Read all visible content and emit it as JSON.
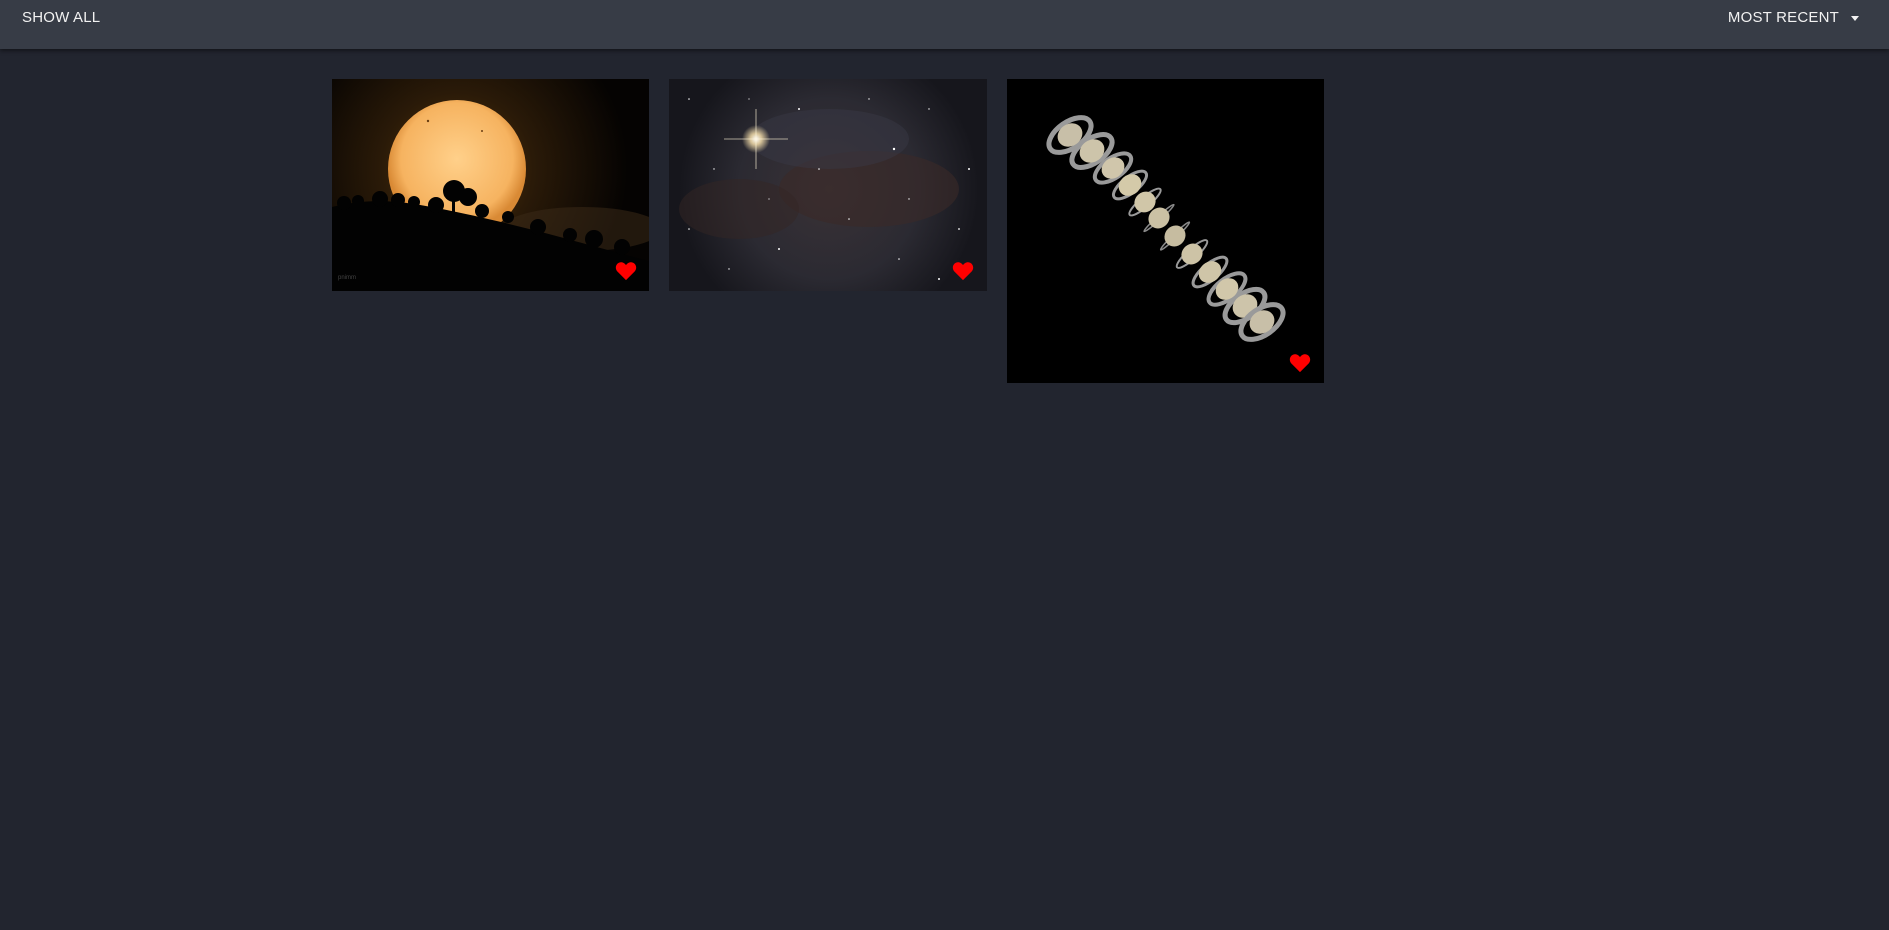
{
  "toolbar": {
    "show_all_label": "SHOW ALL",
    "sort_label": "MOST RECENT"
  },
  "gallery": {
    "items": [
      {
        "name": "sun-trees",
        "favorited": true
      },
      {
        "name": "nebula",
        "favorited": true
      },
      {
        "name": "saturn-sequence",
        "favorited": true
      }
    ]
  },
  "colors": {
    "background": "#22252f",
    "toolbar": "#373c46",
    "heart": "#ff0000",
    "text": "#f2f2f2"
  }
}
